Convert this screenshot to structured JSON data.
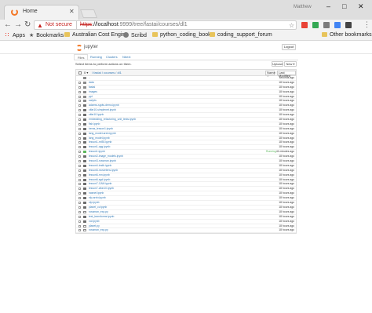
{
  "browser": {
    "tab_title": "Home",
    "tab_close": "✕",
    "user_name": "Matthew",
    "url_warning": "Not secure",
    "url_scheme": "https",
    "url_host": "://localhost",
    "url_rest": ":9999/tree/fastai/courses/dl1",
    "bookmarks": [
      {
        "label": "Apps",
        "kind": "apps-icon"
      },
      {
        "label": "Bookmarks",
        "kind": "star-icon"
      },
      {
        "label": "Australian Cost Engin",
        "kind": "folder-icon"
      },
      {
        "label": "Scribd",
        "kind": "scribd-icon"
      },
      {
        "label": "python_coding_book",
        "kind": "folder-icon"
      },
      {
        "label": "coding_support_forum",
        "kind": "folder-icon"
      }
    ],
    "other_bookmarks": "Other bookmarks"
  },
  "jupyter": {
    "title": "jupyter",
    "logout_label": "Logout",
    "tabs": [
      "Files",
      "Running",
      "Clusters",
      "Nbext"
    ],
    "hint": "Select items to perform actions on them.",
    "upload_label": "Upload",
    "new_label": "New ▾",
    "head_count": "0 ▾",
    "breadcrumb": "/ fastai / courses / dl1",
    "sort_name": "Name ↓",
    "sort_modified": "Last Modified"
  },
  "files": [
    {
      "name": "..",
      "type": "parent",
      "modified": "seconds ago"
    },
    {
      "name": "data",
      "type": "folder",
      "modified": "18 hours ago"
    },
    {
      "name": "fastai",
      "type": "folder",
      "modified": "18 hours ago"
    },
    {
      "name": "images",
      "type": "folder",
      "modified": "18 hours ago"
    },
    {
      "name": "ppt",
      "type": "folder",
      "modified": "18 hours ago"
    },
    {
      "name": "scripts",
      "type": "folder",
      "modified": "18 hours ago"
    },
    {
      "name": "adamw-sgdw-demo.ipynb",
      "type": "nb",
      "modified": "18 hours ago"
    },
    {
      "name": "cifar10-simplenet.ipynb",
      "type": "nb",
      "modified": "18 hours ago"
    },
    {
      "name": "cifar10.ipynb",
      "type": "nb",
      "modified": "18 hours ago"
    },
    {
      "name": "embedding_refactoring_unit_tests.ipynb",
      "type": "nb",
      "modified": "18 hours ago"
    },
    {
      "name": "fish.ipynb",
      "type": "nb",
      "modified": "18 hours ago"
    },
    {
      "name": "keras_lesson1.ipynb",
      "type": "nb",
      "modified": "18 hours ago"
    },
    {
      "name": "lang_model-arxiv.ipynb",
      "type": "nb",
      "modified": "18 hours ago"
    },
    {
      "name": "lang_model.ipynb",
      "type": "nb",
      "modified": "18 hours ago"
    },
    {
      "name": "lesson1-rxt50.ipynb",
      "type": "nb",
      "modified": "18 hours ago"
    },
    {
      "name": "lesson1-vgg.ipynb",
      "type": "nb",
      "modified": "18 hours ago"
    },
    {
      "name": "lesson1.ipynb",
      "type": "nb",
      "running": true,
      "status": "Running",
      "modified": "41 minutes ago"
    },
    {
      "name": "lesson2-image_models.ipynb",
      "type": "nb",
      "modified": "18 hours ago"
    },
    {
      "name": "lesson3-rossman.ipynb",
      "type": "nb",
      "modified": "18 hours ago"
    },
    {
      "name": "lesson4-imdb.ipynb",
      "type": "nb",
      "modified": "18 hours ago"
    },
    {
      "name": "lesson5-movielens.ipynb",
      "type": "nb",
      "modified": "18 hours ago"
    },
    {
      "name": "lesson6-rnn.ipynb",
      "type": "nb",
      "modified": "18 hours ago"
    },
    {
      "name": "lesson6-sgd.ipynb",
      "type": "nb",
      "modified": "18 hours ago"
    },
    {
      "name": "lesson7-CAM.ipynb",
      "type": "nb",
      "modified": "18 hours ago"
    },
    {
      "name": "lesson7-cifar10.ipynb",
      "type": "nb",
      "modified": "18 hours ago"
    },
    {
      "name": "nasnet.ipynb",
      "type": "nb",
      "modified": "18 hours ago"
    },
    {
      "name": "nlp-arxiv.ipynb",
      "type": "nb",
      "modified": "18 hours ago"
    },
    {
      "name": "nlp.ipynb",
      "type": "nb",
      "modified": "18 hours ago"
    },
    {
      "name": "planet_cv.ipynb",
      "type": "nb",
      "modified": "18 hours ago"
    },
    {
      "name": "rossman_exp.py",
      "type": "file",
      "modified": "18 hours ago"
    },
    {
      "name": "test_transforms.ipynb",
      "type": "nb",
      "modified": "18 hours ago"
    },
    {
      "name": "xor.ipynb",
      "type": "nb",
      "modified": "18 hours ago"
    },
    {
      "name": "planet.py",
      "type": "file",
      "modified": "18 hours ago"
    },
    {
      "name": "rossman_exp.py",
      "type": "file",
      "modified": "18 hours ago"
    }
  ]
}
